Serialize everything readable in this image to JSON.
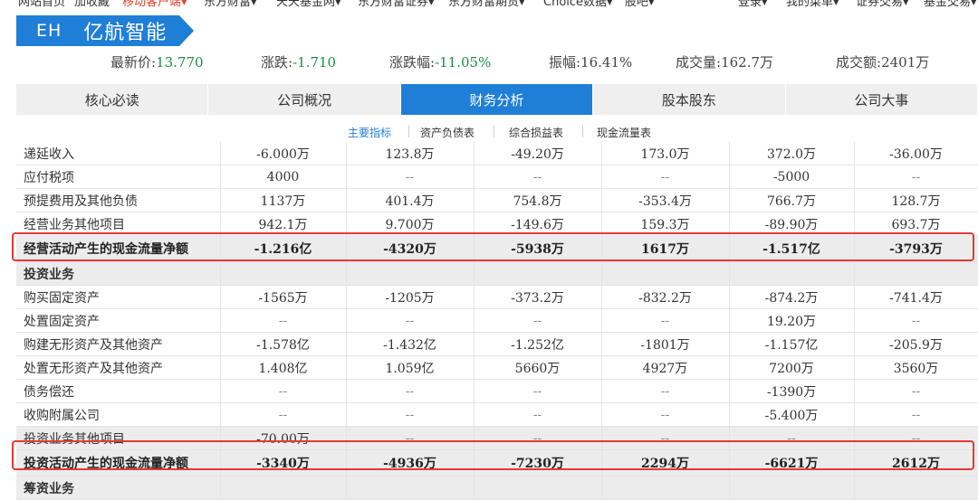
{
  "topnav": {
    "items": [
      "网站首页",
      "加收藏",
      "移动客户端▾",
      "东方财富▾",
      "天天基金网▾",
      "东方财富证券▾",
      "东方财富期货▾",
      "Choice数据▾",
      "股吧▾"
    ],
    "right_items": [
      "登录▾",
      "我的菜单▾",
      "证券交易▾",
      "基金交易▾"
    ]
  },
  "stock": {
    "code": "EH",
    "name": "亿航智能"
  },
  "quote": {
    "price_label": "最新价:",
    "price": "13.770",
    "change_label": "涨跌:",
    "change": "-1.710",
    "change_pct_label": "涨跌幅:",
    "change_pct": "-11.05%",
    "amplitude_label": "振幅:",
    "amplitude": "16.41%",
    "volume_label": "成交量:",
    "volume": "162.7万",
    "turnover_label": "成交额:",
    "turnover": "2401万"
  },
  "tabs": [
    "核心必读",
    "公司概况",
    "财务分析",
    "股本股东",
    "公司大事"
  ],
  "subtabs": [
    "主要指标",
    "资产负债表",
    "综合损益表",
    "现金流量表"
  ],
  "table": {
    "rows": [
      {
        "label": "递延收入",
        "values": [
          "-6.000万",
          "123.8万",
          "-49.20万",
          "173.0万",
          "372.0万",
          "-36.00万"
        ],
        "type": "normal"
      },
      {
        "label": "应付税项",
        "values": [
          "4000",
          "--",
          "--",
          "--",
          "-5000",
          "--"
        ],
        "type": "normal"
      },
      {
        "label": "预提费用及其他负债",
        "values": [
          "1137万",
          "401.4万",
          "754.8万",
          "-353.4万",
          "766.7万",
          "128.7万"
        ],
        "type": "normal"
      },
      {
        "label": "经营业务其他项目",
        "values": [
          "942.1万",
          "9.700万",
          "-149.6万",
          "159.3万",
          "-89.90万",
          "693.7万"
        ],
        "type": "normal"
      },
      {
        "label": "经营活动产生的现金流量净额",
        "values": [
          "-1.216亿",
          "-4320万",
          "-5938万",
          "1617万",
          "-1.517亿",
          "-3793万"
        ],
        "type": "total"
      },
      {
        "label": "投资业务",
        "values": [
          "",
          "",
          "",
          "",
          "",
          ""
        ],
        "type": "section"
      },
      {
        "label": "购买固定资产",
        "values": [
          "-1565万",
          "-1205万",
          "-373.2万",
          "-832.2万",
          "-874.2万",
          "-741.4万"
        ],
        "type": "normal"
      },
      {
        "label": "处置固定资产",
        "values": [
          "--",
          "--",
          "--",
          "--",
          "19.20万",
          "--"
        ],
        "type": "normal"
      },
      {
        "label": "购建无形资产及其他资产",
        "values": [
          "-1.578亿",
          "-1.432亿",
          "-1.252亿",
          "-1801万",
          "-1.157亿",
          "-205.9万"
        ],
        "type": "normal"
      },
      {
        "label": "处置无形资产及其他资产",
        "values": [
          "1.408亿",
          "1.059亿",
          "5660万",
          "4927万",
          "7200万",
          "3560万"
        ],
        "type": "normal"
      },
      {
        "label": "债务偿还",
        "values": [
          "--",
          "--",
          "--",
          "--",
          "-1390万",
          "--"
        ],
        "type": "normal"
      },
      {
        "label": "收购附属公司",
        "values": [
          "--",
          "--",
          "--",
          "--",
          "-5.400万",
          "--"
        ],
        "type": "normal"
      },
      {
        "label": "投资业务其他项目",
        "values": [
          "-70.00万",
          "--",
          "--",
          "--",
          "--",
          "--"
        ],
        "type": "gray"
      },
      {
        "label": "投资活动产生的现金流量净额",
        "values": [
          "-3340万",
          "-4936万",
          "-7230万",
          "2294万",
          "-6621万",
          "2612万"
        ],
        "type": "total"
      },
      {
        "label": "筹资业务",
        "values": [
          "",
          "",
          "",
          "",
          "",
          ""
        ],
        "type": "section"
      }
    ]
  },
  "colors": {
    "accent": "#1f7ed6",
    "highlight": "#e53935",
    "quote_value": "#1c8d45",
    "nav_highlight": "#e0442b"
  }
}
